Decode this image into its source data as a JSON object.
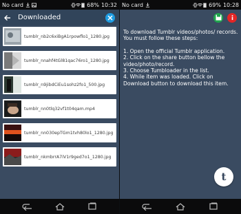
{
  "left_screen": {
    "status": {
      "carrier": "No card",
      "battery": "68%",
      "time": "10:32"
    },
    "title": "Downloaded",
    "items": [
      {
        "filename": "tumblr_nb2c6xiBgA1rpowflo1_1280.jpg"
      },
      {
        "filename": "tumblr_nnahf4tGl81qac76ro1_1280.jpg"
      },
      {
        "filename": "tumblr_n9jibdCiEu1sohz2fo1_500.jpg"
      },
      {
        "filename": "tumblr_nn0tlq32vf1t04qam.mp4"
      },
      {
        "filename": "tumblr_nn030epTGm1tvh80lo1_1280.jpg"
      },
      {
        "filename": "tumblr_nkmbrrA7iV1r9ged7o1_1280.jpg"
      }
    ]
  },
  "right_screen": {
    "status": {
      "carrier": "No card",
      "battery": "69%",
      "time": "10:28"
    },
    "intro": "To download Tumblr videos/photos/ records. You must follow these steps:",
    "steps": [
      "1. Open the official Tumblr application.",
      "2. Click on the share button bellow the video/photo/record.",
      "3. Choose Tumbloader in the list.",
      "4. While item was loaded. Click on Download button to download this item."
    ],
    "fab_label": "t"
  },
  "colors": {
    "app_bg": "#3a4b61",
    "toolbar_accent": "#1e9be0",
    "save_green": "#1fa44d",
    "info_red": "#e32626"
  }
}
